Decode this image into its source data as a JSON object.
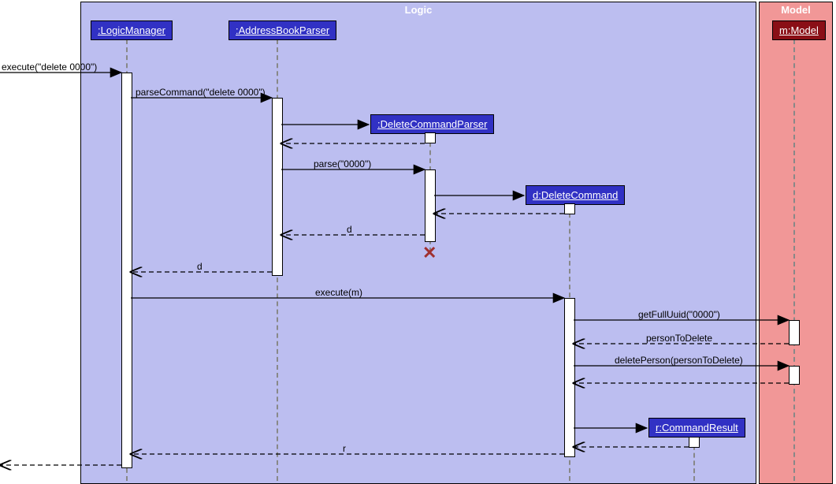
{
  "frames": {
    "logic": {
      "title": "Logic",
      "bg": "#bcbef0"
    },
    "model": {
      "title": "Model",
      "bg": "#f19797"
    }
  },
  "objects": {
    "logicManager": ":LogicManager",
    "parser": ":AddressBookParser",
    "dcp": ":DeleteCommandParser",
    "dc": "d:DeleteCommand",
    "cr": "r:CommandResult",
    "model": "m:Model"
  },
  "messages": {
    "m1": "execute(\"delete 0000\")",
    "m2": "parseCommand(\"delete 0000\")",
    "m3": "parse(\"0000\")",
    "m4": "d",
    "m5": "d",
    "m6": "execute(m)",
    "m7": "getFullUuid(\"0000\")",
    "m8": "personToDelete",
    "m9": "deletePerson(personToDelete)",
    "m10": "r"
  },
  "chart_data": {
    "type": "sequence",
    "frames": [
      {
        "name": "Logic",
        "participants": [
          ":LogicManager",
          ":AddressBookParser",
          ":DeleteCommandParser",
          "d:DeleteCommand",
          "r:CommandResult"
        ]
      },
      {
        "name": "Model",
        "participants": [
          "m:Model"
        ]
      }
    ],
    "messages": [
      {
        "from": "external",
        "to": ":LogicManager",
        "label": "execute(\"delete 0000\")",
        "kind": "sync"
      },
      {
        "from": ":LogicManager",
        "to": ":AddressBookParser",
        "label": "parseCommand(\"delete 0000\")",
        "kind": "sync"
      },
      {
        "from": ":AddressBookParser",
        "to": ":DeleteCommandParser",
        "label": "",
        "kind": "create"
      },
      {
        "from": ":DeleteCommandParser",
        "to": ":AddressBookParser",
        "label": "",
        "kind": "return"
      },
      {
        "from": ":AddressBookParser",
        "to": ":DeleteCommandParser",
        "label": "parse(\"0000\")",
        "kind": "sync"
      },
      {
        "from": ":DeleteCommandParser",
        "to": "d:DeleteCommand",
        "label": "",
        "kind": "create"
      },
      {
        "from": "d:DeleteCommand",
        "to": ":DeleteCommandParser",
        "label": "",
        "kind": "return"
      },
      {
        "from": ":DeleteCommandParser",
        "to": ":AddressBookParser",
        "label": "d",
        "kind": "return"
      },
      {
        "from": ":DeleteCommandParser",
        "to": "destroy",
        "label": "",
        "kind": "destroy"
      },
      {
        "from": ":AddressBookParser",
        "to": ":LogicManager",
        "label": "d",
        "kind": "return"
      },
      {
        "from": ":LogicManager",
        "to": "d:DeleteCommand",
        "label": "execute(m)",
        "kind": "sync"
      },
      {
        "from": "d:DeleteCommand",
        "to": "m:Model",
        "label": "getFullUuid(\"0000\")",
        "kind": "sync"
      },
      {
        "from": "m:Model",
        "to": "d:DeleteCommand",
        "label": "personToDelete",
        "kind": "return"
      },
      {
        "from": "d:DeleteCommand",
        "to": "m:Model",
        "label": "deletePerson(personToDelete)",
        "kind": "sync"
      },
      {
        "from": "m:Model",
        "to": "d:DeleteCommand",
        "label": "",
        "kind": "return"
      },
      {
        "from": "d:DeleteCommand",
        "to": "r:CommandResult",
        "label": "",
        "kind": "create"
      },
      {
        "from": "r:CommandResult",
        "to": "d:DeleteCommand",
        "label": "",
        "kind": "return"
      },
      {
        "from": "d:DeleteCommand",
        "to": ":LogicManager",
        "label": "r",
        "kind": "return"
      },
      {
        "from": ":LogicManager",
        "to": "external",
        "label": "",
        "kind": "return"
      }
    ]
  }
}
